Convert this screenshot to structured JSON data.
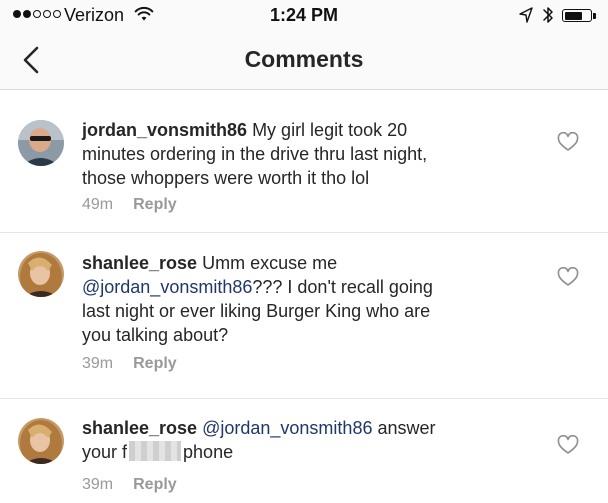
{
  "status_bar": {
    "carrier": "Verizon",
    "time": "1:24 PM",
    "signal_full": 2,
    "signal_total": 5,
    "battery_level": 0.7
  },
  "nav": {
    "title": "Comments",
    "back_icon": "chevron-left-icon"
  },
  "comments": [
    {
      "username": "jordan_vonsmith86",
      "text_lines": [
        "My girl legit took 20",
        "minutes ordering in the drive thru last night,",
        "those whoppers were worth it tho lol"
      ],
      "time": "49m",
      "reply_label": "Reply"
    },
    {
      "username": "shanlee_rose",
      "text_line1": "Umm excuse me",
      "mention": "@jordan_vonsmith86",
      "text_after_mention": "??? I don't recall going",
      "text_lines_rest": [
        "last night or ever liking Burger King who are",
        "you talking about?"
      ],
      "time": "39m",
      "reply_label": "Reply"
    },
    {
      "username": "shanlee_rose",
      "mention": "@jordan_vonsmith86",
      "text_after_mention": "answer",
      "text_before_blur": "your f",
      "text_after_blur": "phone",
      "time": "39m",
      "reply_label": "Reply"
    }
  ]
}
